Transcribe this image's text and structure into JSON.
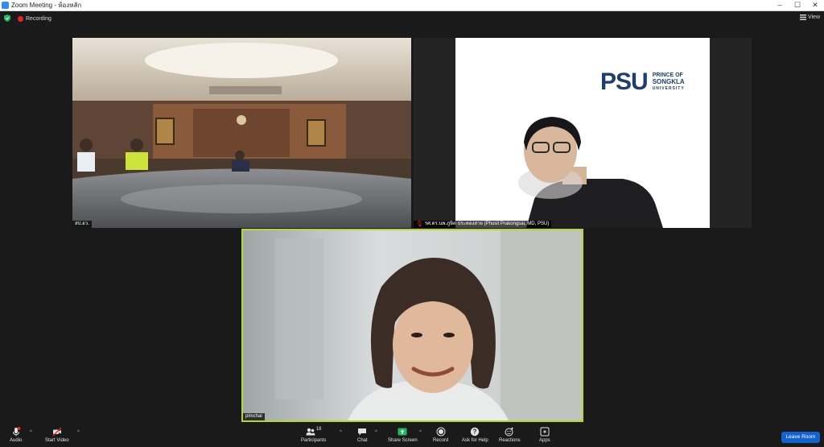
{
  "window": {
    "title": "Zoom Meeting - ห้องหลัก",
    "accent": "#2d8cff"
  },
  "topbar": {
    "recording_label": "Recording",
    "view_label": "View",
    "recording_color": "#e02828"
  },
  "tiles": [
    {
      "name": "สป.อว.",
      "kind": "conference-room",
      "banner_text": "กระทรวงการอุดมศึกษา วิทยาศาสตร์ วิจัยและนวัตกรรม"
    },
    {
      "name": "รศ.ดร.นพ.ภูษิต ประคองสาย (Phusit Prakongsai, MD, PSU)",
      "kind": "logo-slide",
      "logo": {
        "mark": "PSU",
        "line1": "PRINCE OF",
        "line2": "SONGKLA",
        "line3": "UNIVERSITY",
        "color": "#1d3e6e"
      }
    },
    {
      "name": "pimchai",
      "kind": "active-speaker",
      "highlight_color": "#b4d639"
    }
  ],
  "toolbar": {
    "audio": "Audio",
    "start_video": "Start Video",
    "participants": "Participants",
    "participant_count": "18",
    "chat": "Chat",
    "share_screen": "Share Screen",
    "record": "Record",
    "ask_for_help": "Ask for Help",
    "reactions": "Reactions",
    "apps": "Apps",
    "leave_room": "Leave Room",
    "share_color": "#20b95e",
    "leave_color": "#1462d2"
  }
}
